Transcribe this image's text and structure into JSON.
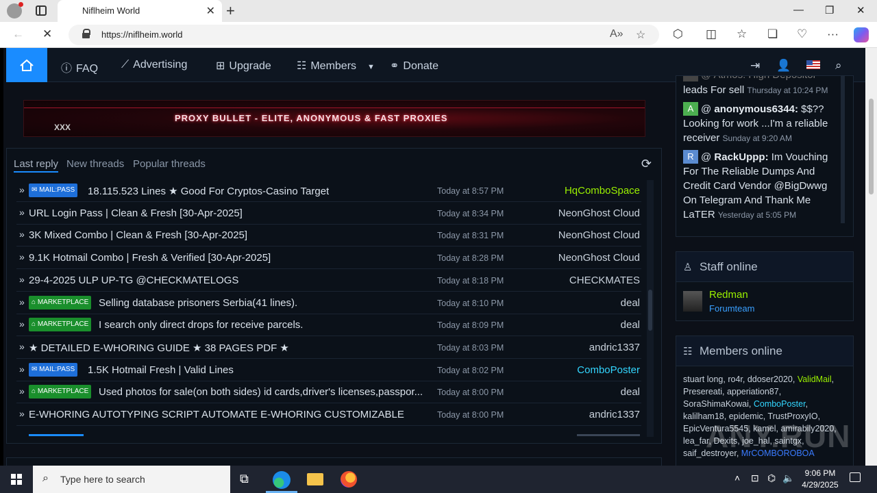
{
  "browser": {
    "tab_title": "Niflheim World",
    "url": "https://niflheim.world"
  },
  "sitenav": {
    "items": [
      {
        "label": "FAQ",
        "icon": "question-circle-icon"
      },
      {
        "label": "Advertising",
        "icon": "chart-line-icon"
      },
      {
        "label": "Upgrade",
        "icon": "gift-icon"
      },
      {
        "label": "Members",
        "icon": "users-icon"
      },
      {
        "label": "Donate",
        "icon": "handshake-icon"
      }
    ]
  },
  "banner": {
    "text": "PROXY BULLET - ELITE, ANONYMOUS & FAST PROXIES",
    "tag": "XXX"
  },
  "threads": {
    "tabs": [
      "Last reply",
      "New threads",
      "Popular threads"
    ],
    "rows": [
      {
        "badge": "MAIL:PASS",
        "badge_type": "mail",
        "title": "18.115.523 Lines ★ Good For Cryptos-Casino Target",
        "time": "Today at 8:57 PM",
        "user": "HqComboSpace",
        "user_color": "green"
      },
      {
        "badge": "",
        "badge_type": "",
        "title": "URL Login Pass | Clean & Fresh [30-Apr-2025]",
        "time": "Today at 8:34 PM",
        "user": "NeonGhost Cloud",
        "user_color": ""
      },
      {
        "badge": "",
        "badge_type": "",
        "title": "3K Mixed Combo | Clean & Fresh [30-Apr-2025]",
        "time": "Today at 8:31 PM",
        "user": "NeonGhost Cloud",
        "user_color": ""
      },
      {
        "badge": "",
        "badge_type": "",
        "title": "9.1K Hotmail Combo | Fresh & Verified [30-Apr-2025]",
        "time": "Today at 8:28 PM",
        "user": "NeonGhost Cloud",
        "user_color": ""
      },
      {
        "badge": "",
        "badge_type": "",
        "title": "29-4-2025 ULP UP-TG @CHECKMATELOGS",
        "time": "Today at 8:18 PM",
        "user": "CHECKMATES",
        "user_color": ""
      },
      {
        "badge": "MARKETPLACE",
        "badge_type": "market",
        "title": "Selling database prisoners Serbia(41 lines).",
        "time": "Today at 8:10 PM",
        "user": "deal",
        "user_color": ""
      },
      {
        "badge": "MARKETPLACE",
        "badge_type": "market",
        "title": "I search only direct drops for receive parcels.",
        "time": "Today at 8:09 PM",
        "user": "deal",
        "user_color": ""
      },
      {
        "badge": "",
        "badge_type": "",
        "title": "★ DETAILED E-WHORING GUIDE ★ 38 PAGES PDF ★",
        "time": "Today at 8:03 PM",
        "user": "andric1337",
        "user_color": ""
      },
      {
        "badge": "MAIL:PASS",
        "badge_type": "mail",
        "title": "1.5K Hotmail Fresh | Valid Lines",
        "time": "Today at 8:02 PM",
        "user": "ComboPoster",
        "user_color": "cyan"
      },
      {
        "badge": "MARKETPLACE",
        "badge_type": "market",
        "title": "Used photos for sale(on both sides) id cards,driver's licenses,passpor...",
        "time": "Today at 8:00 PM",
        "user": "deal",
        "user_color": ""
      },
      {
        "badge": "",
        "badge_type": "",
        "title": "E-WHORING AUTOTYPING SCRIPT AUTOMATE E-WHORING CUSTOMIZABLE",
        "time": "Today at 8:00 PM",
        "user": "andric1337",
        "user_color": ""
      }
    ]
  },
  "chat": {
    "top_partial": "@ Atmos: High Depositor",
    "msg1_text": "leads For sell",
    "msg1_time": "Thursday at 10:24 PM",
    "msg2_avatar": "A",
    "msg2_user": "anonymous6344:",
    "msg2_text": "$$?? Looking for work ...I'm a reliable receiver",
    "msg2_time": "Sunday at 9:20 AM",
    "msg3_avatar": "R",
    "msg3_user": "RackUppp:",
    "msg3_text": "Im Vouching For The Reliable Dumps And Credit Card Vendor @BigDwwg On Telegram And Thank Me LaTER",
    "msg3_time": "Yesterday at 5:05 PM"
  },
  "staff": {
    "title": "Staff online",
    "name": "Redman",
    "role": "Forumteam"
  },
  "members": {
    "title": "Members online",
    "list": [
      {
        "name": "stuart long",
        "color": ""
      },
      {
        "name": "ro4r",
        "color": ""
      },
      {
        "name": "ddoser2020",
        "color": ""
      },
      {
        "name": "ValidMail",
        "color": "g"
      },
      {
        "name": "Presereati",
        "color": ""
      },
      {
        "name": "apperiation87",
        "color": ""
      },
      {
        "name": "SoraShimaKowai",
        "color": ""
      },
      {
        "name": "ComboPoster",
        "color": "c"
      },
      {
        "name": "kalilham18",
        "color": ""
      },
      {
        "name": "epidemic",
        "color": ""
      },
      {
        "name": "TrustProxyIO",
        "color": ""
      },
      {
        "name": "EpicVentura5545",
        "color": ""
      },
      {
        "name": "kamel",
        "color": ""
      },
      {
        "name": "amirabily2020",
        "color": ""
      },
      {
        "name": "lea_far",
        "color": ""
      },
      {
        "name": "Dexits",
        "color": ""
      },
      {
        "name": "joe_hal",
        "color": ""
      },
      {
        "name": "saintgx",
        "color": ""
      },
      {
        "name": "saif_destroyer",
        "color": ""
      },
      {
        "name": "MrCOMBOROBOA",
        "color": "b"
      }
    ]
  },
  "watermark": "ANY.RUN",
  "taskbar": {
    "search_placeholder": "Type here to search",
    "time": "9:06 PM",
    "date": "4/29/2025"
  }
}
